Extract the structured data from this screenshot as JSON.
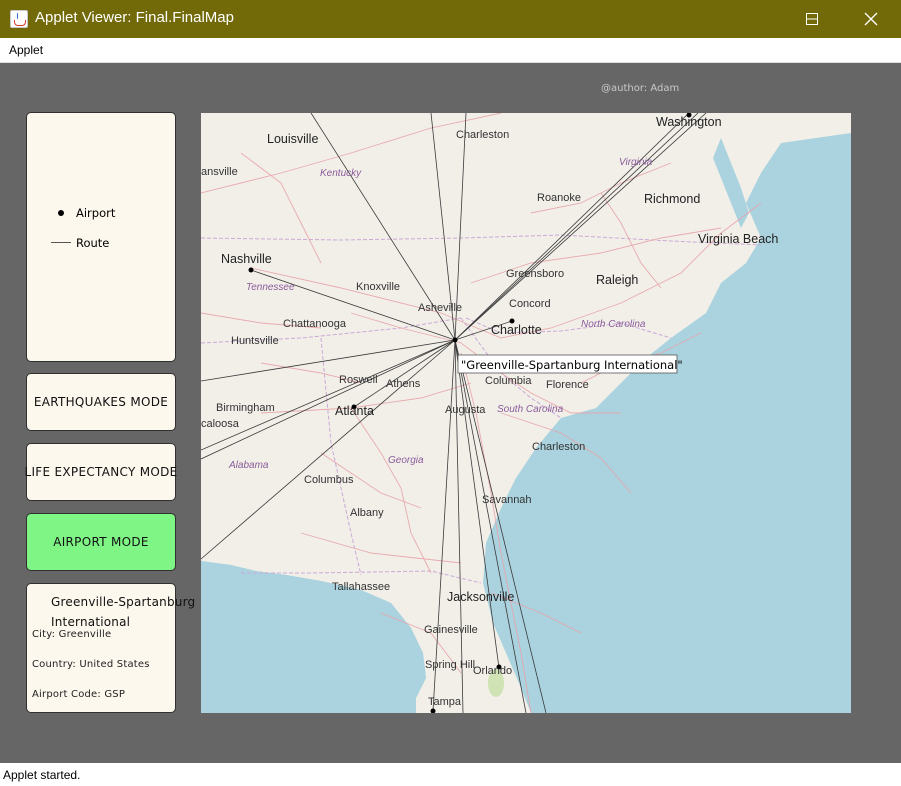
{
  "window": {
    "title": "Applet Viewer: Final.FinalMap"
  },
  "menu": {
    "items": [
      "Applet"
    ]
  },
  "author": "@author: Adam",
  "legend": {
    "airport_label": "Airport",
    "route_label": "Route"
  },
  "modes": {
    "earthquakes": "EARTHQUAKES MODE",
    "life_expectancy": "LIFE EXPECTANCY MODE",
    "airport": "AIRPORT MODE",
    "active_color": "#7ff585"
  },
  "info": {
    "name": "Greenville-Spartanburg\nInternational",
    "city": "City: Greenville",
    "country": "Country: United States",
    "code": "Airport Code: GSP"
  },
  "map": {
    "selected_label": "\"Greenville-Spartanburg International\"",
    "cities": [
      "Louisville",
      "Charleston",
      "Washington",
      "Richmond",
      "Virginia Beach",
      "Roanoke",
      "Nashville",
      "Knoxville",
      "Greensboro",
      "Raleigh",
      "Concord",
      "Asheville",
      "Charlotte",
      "Chattanooga",
      "Huntsville",
      "Roswell",
      "Athens",
      "Columbia",
      "Florence",
      "Birmingham",
      "Atlanta",
      "Augusta",
      "Charleston",
      "Columbus",
      "Albany",
      "Savannah",
      "Tallahassee",
      "Jacksonville",
      "Gainesville",
      "Spring Hill",
      "Orlando",
      "Tampa",
      "ansville",
      "caloosa"
    ],
    "states": [
      "Kentucky",
      "Virginia",
      "Tennessee",
      "North Carolina",
      "South Carolina",
      "Alabama",
      "Georgia"
    ]
  },
  "status": "Applet started."
}
